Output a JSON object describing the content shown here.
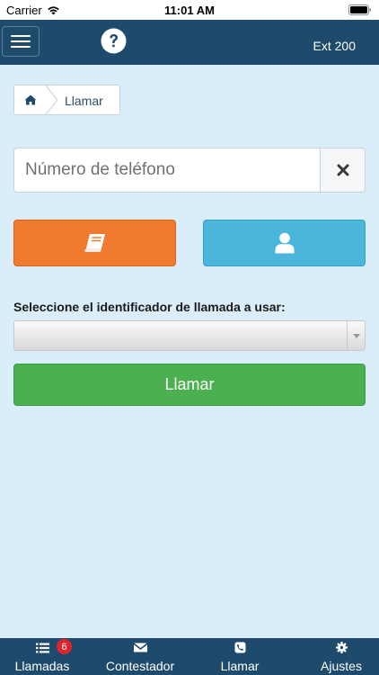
{
  "status_bar": {
    "carrier": "Carrier",
    "time": "11:01 AM"
  },
  "header": {
    "extension": "Ext 200",
    "icons": {
      "menu": "hamburger-menu-icon",
      "help": "question-circle-icon"
    }
  },
  "breadcrumb": {
    "home_icon": "home-icon",
    "current": "Llamar"
  },
  "dialer": {
    "phone_placeholder": "Número de teléfono",
    "phone_value": "",
    "clear_icon": "close-icon",
    "phonebook_icon": "book-icon",
    "contacts_icon": "user-icon"
  },
  "caller_id": {
    "label": "Seleccione el identificador de llamada a usar:",
    "selected": ""
  },
  "call_button": {
    "label": "Llamar"
  },
  "tab_bar": {
    "tabs": [
      {
        "label": "Llamadas",
        "icon": "list-icon",
        "badge": "6"
      },
      {
        "label": "Contestador",
        "icon": "envelope-icon"
      },
      {
        "label": "Llamar",
        "icon": "phone-icon"
      },
      {
        "label": "Ajustes",
        "icon": "gear-icon"
      }
    ]
  },
  "colors": {
    "nav": "#1e4a6c",
    "background": "#d9eef9",
    "phonebook": "#f07b2e",
    "contacts": "#4bb6dc",
    "call": "#4caf50",
    "badge": "#e0242b"
  }
}
